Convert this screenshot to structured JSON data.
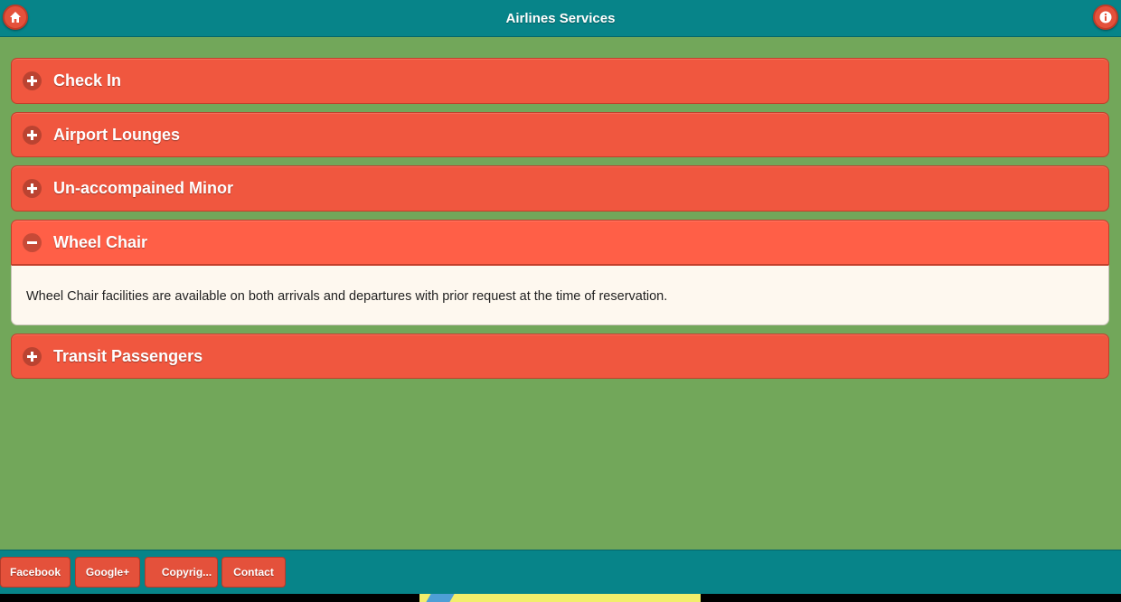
{
  "header": {
    "title": "Airlines Services",
    "home_icon": "home-icon",
    "info_icon": "info-icon"
  },
  "sections": [
    {
      "title": "Check In",
      "expanded": false
    },
    {
      "title": "Airport Lounges",
      "expanded": false
    },
    {
      "title": "Un-accompained Minor",
      "expanded": false
    },
    {
      "title": "Wheel Chair",
      "expanded": true,
      "body": "Wheel Chair facilities are available on both arrivals and departures with prior request at the time of reservation."
    },
    {
      "title": "Transit Passengers",
      "expanded": false
    }
  ],
  "footer": {
    "buttons": [
      {
        "label": "Facebook"
      },
      {
        "label": "Google+"
      },
      {
        "label": "Copyrig..."
      },
      {
        "label": "Contact"
      }
    ]
  },
  "colors": {
    "page_background": "#72a75a",
    "header_background": "#078489",
    "accent": "#f0573f",
    "accent_active": "#ff5f47",
    "panel_background": "#fef8ef"
  }
}
